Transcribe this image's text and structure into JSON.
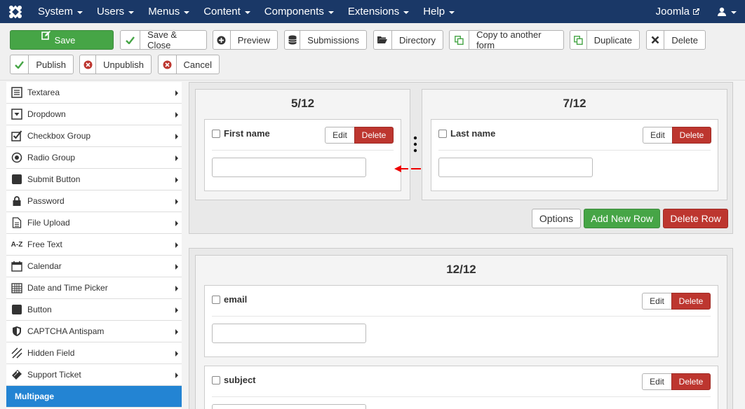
{
  "navbar": {
    "menus": [
      "System",
      "Users",
      "Menus",
      "Content",
      "Components",
      "Extensions",
      "Help"
    ],
    "site_name": "Joomla"
  },
  "toolbar": {
    "save": "Save",
    "save_close": "Save & Close",
    "preview": "Preview",
    "submissions": "Submissions",
    "directory": "Directory",
    "copy_form": "Copy to another form",
    "duplicate": "Duplicate",
    "delete": "Delete",
    "publish": "Publish",
    "unpublish": "Unpublish",
    "cancel": "Cancel"
  },
  "sidebar": {
    "items": [
      {
        "label": "Textarea",
        "icon": "textarea-icon"
      },
      {
        "label": "Dropdown",
        "icon": "dropdown-icon"
      },
      {
        "label": "Checkbox Group",
        "icon": "checkbox-icon"
      },
      {
        "label": "Radio Group",
        "icon": "radio-icon"
      },
      {
        "label": "Submit Button",
        "icon": "button-icon"
      },
      {
        "label": "Password",
        "icon": "lock-icon"
      },
      {
        "label": "File Upload",
        "icon": "file-icon"
      },
      {
        "label": "Free Text",
        "icon": "text-icon"
      },
      {
        "label": "Calendar",
        "icon": "calendar-icon"
      },
      {
        "label": "Date and Time Picker",
        "icon": "datetime-icon"
      },
      {
        "label": "Button",
        "icon": "button-icon"
      },
      {
        "label": "CAPTCHA Antispam",
        "icon": "shield-icon"
      },
      {
        "label": "Hidden Field",
        "icon": "hidden-icon"
      },
      {
        "label": "Support Ticket",
        "icon": "ticket-icon"
      }
    ],
    "active": "Multipage",
    "free_text_icon_text": "A-Z"
  },
  "rows": [
    {
      "columns": [
        {
          "title": "5/12",
          "field": "First name"
        },
        {
          "title": "7/12",
          "field": "Last name"
        }
      ],
      "options": "Options",
      "add_row": "Add New Row",
      "delete_row": "Delete Row"
    },
    {
      "columns": [
        {
          "title": "12/12",
          "fields": [
            "email",
            "subject"
          ]
        }
      ]
    }
  ],
  "field_buttons": {
    "edit": "Edit",
    "delete": "Delete"
  }
}
